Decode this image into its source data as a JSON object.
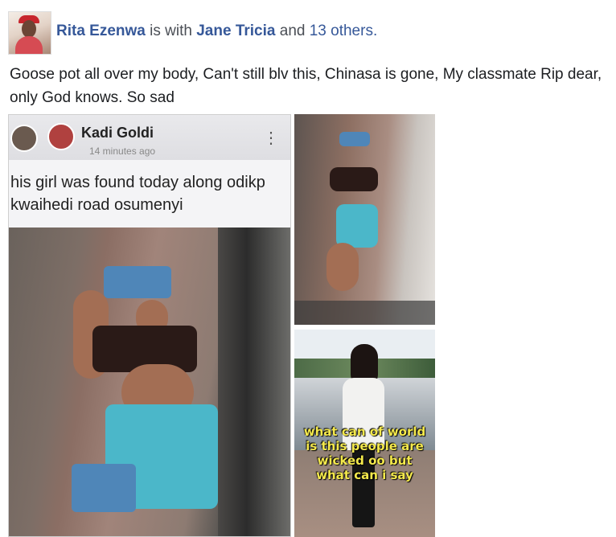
{
  "post": {
    "author": "Rita Ezenwa",
    "with_text": "is with",
    "tagged": "Jane Tricia",
    "and_text": "and",
    "others": "13 others.",
    "body": "Goose pot all over my body, Can't still blv this, Chinasa is gone, My classmate Rip dear, only God knows. So sad"
  },
  "photo1": {
    "user": "Kadi Goldi",
    "time": "14 minutes ago",
    "caption": "his girl was found today along odikp kwaihedi road osumenyi"
  },
  "photo3": {
    "overlay": "what can of world is this people are wicked oo but what can i say"
  },
  "colors": {
    "name_link": "#365899",
    "overlay_text": "#f4e94c"
  }
}
